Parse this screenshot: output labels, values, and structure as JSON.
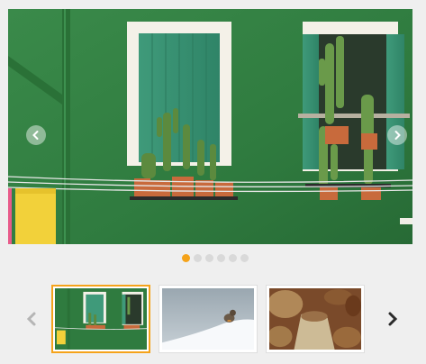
{
  "gallery": {
    "slide_count": 6,
    "active_slide": 1,
    "colors": {
      "accent": "#f5a31a",
      "dot_inactive": "#d9d9d9",
      "wall_green": "#2e7a3e"
    },
    "icons": {
      "main_prev": "chevron-left-icon",
      "main_next": "chevron-right-icon",
      "thumb_prev": "chevron-left-icon",
      "thumb_next": "chevron-right-icon"
    },
    "thumbnails": [
      {
        "subject": "green-wall-windows",
        "selected": true
      },
      {
        "subject": "bird-on-snow",
        "selected": false
      },
      {
        "subject": "grain-sacks",
        "selected": false
      }
    ]
  }
}
